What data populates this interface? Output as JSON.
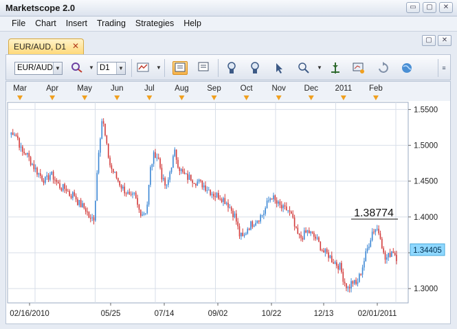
{
  "app": {
    "title": "Marketscope 2.0"
  },
  "window_controls": {
    "minimize": "▭",
    "restore": "▢",
    "close": "✕"
  },
  "menu": [
    "File",
    "Chart",
    "Insert",
    "Trading",
    "Strategies",
    "Help"
  ],
  "chart_tab": {
    "label": "EUR/AUD, D1",
    "close": "✕"
  },
  "toolbar": {
    "instrument": "EUR/AUD",
    "timeframe": "D1"
  },
  "chart_data": {
    "type": "candlestick",
    "months": [
      "Mar",
      "Apr",
      "May",
      "Jun",
      "Jul",
      "Aug",
      "Sep",
      "Oct",
      "Nov",
      "Dec",
      "2011",
      "Feb"
    ],
    "date_labels": [
      "02/16/2010",
      "05/25",
      "07/14",
      "09/02",
      "10/22",
      "12/13",
      "02/01/2011"
    ],
    "ylim": [
      1.28,
      1.56
    ],
    "y_ticks": [
      "1.5500",
      "1.5000",
      "1.4500",
      "1.4000",
      "1.3500",
      "1.3000"
    ],
    "current_price": "1.34405",
    "annotation": "1.38774",
    "close_path": [
      1.515,
      1.52,
      1.51,
      1.49,
      1.49,
      1.48,
      1.47,
      1.462,
      1.455,
      1.45,
      1.46,
      1.455,
      1.445,
      1.44,
      1.44,
      1.43,
      1.432,
      1.42,
      1.415,
      1.41,
      1.395,
      1.4,
      1.49,
      1.54,
      1.5,
      1.47,
      1.46,
      1.45,
      1.44,
      1.435,
      1.425,
      1.43,
      1.41,
      1.405,
      1.41,
      1.47,
      1.49,
      1.48,
      1.45,
      1.44,
      1.47,
      1.49,
      1.47,
      1.46,
      1.455,
      1.455,
      1.45,
      1.448,
      1.445,
      1.44,
      1.435,
      1.43,
      1.43,
      1.425,
      1.42,
      1.41,
      1.4,
      1.375,
      1.37,
      1.385,
      1.39,
      1.395,
      1.4,
      1.405,
      1.42,
      1.43,
      1.42,
      1.415,
      1.41,
      1.41,
      1.4,
      1.38,
      1.37,
      1.375,
      1.38,
      1.375,
      1.37,
      1.36,
      1.35,
      1.348,
      1.34,
      1.335,
      1.33,
      1.31,
      1.3,
      1.31,
      1.305,
      1.32,
      1.34,
      1.36,
      1.38,
      1.385,
      1.375,
      1.34,
      1.345,
      1.355,
      1.344
    ]
  },
  "colors": {
    "bull": "#3a86d4",
    "bear": "#d23a3a",
    "grid": "#d7dee8",
    "price_badge": "#8fd8ff",
    "marker": "#f0a020"
  }
}
